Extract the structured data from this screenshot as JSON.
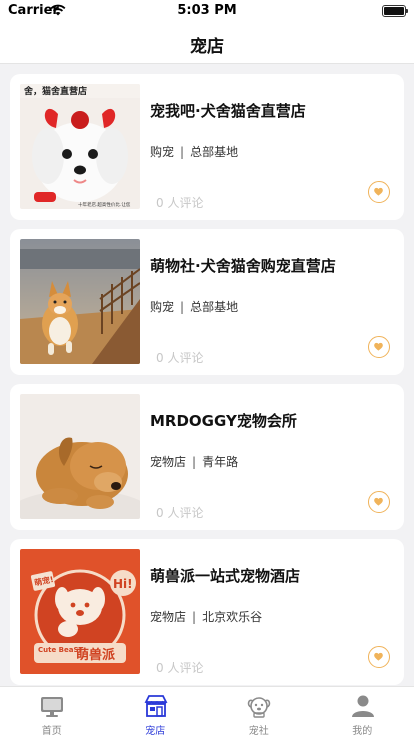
{
  "status": {
    "carrier": "Carrier",
    "time": "5:03 PM"
  },
  "nav": {
    "title": "宠店"
  },
  "stores": [
    {
      "name": "宠我吧·犬舍猫舍直营店",
      "category": "购宠",
      "location": "总部基地",
      "comments": "0 人评论",
      "image": "white-maltese-with-red-bow",
      "image_banner": "舍，猫舍直营店",
      "image_footer": "十年老店.超高性价比.让您"
    },
    {
      "name": "萌物社·犬舍猫舍购宠直营店",
      "category": "购宠",
      "location": "总部基地",
      "comments": "0 人评论",
      "image": "corgi-running-on-path"
    },
    {
      "name": "MRDOGGY宠物会所",
      "category": "宠物店",
      "location": "青年路",
      "comments": "0 人评论",
      "image": "sleeping-golden-puppy"
    },
    {
      "name": "萌兽派一站式宠物酒店",
      "category": "宠物店",
      "location": "北京欢乐谷",
      "comments": "0 人评论",
      "image": "cute-beast-logo-poster",
      "image_logo_en": "Cute BeaST",
      "image_logo_cn": "萌兽派",
      "image_badge_hi": "Hi!",
      "image_badge_left": "萌宠!"
    }
  ],
  "tabs": [
    {
      "label": "首页",
      "icon": "monitor-icon",
      "active": false
    },
    {
      "label": "宠店",
      "icon": "store-icon",
      "active": true
    },
    {
      "label": "宠社",
      "icon": "dog-face-icon",
      "active": false
    },
    {
      "label": "我的",
      "icon": "person-icon",
      "active": false
    }
  ],
  "colors": {
    "accent": "#2a39d8",
    "favorite": "#f0b35a",
    "muted": "#c7c7c7"
  }
}
